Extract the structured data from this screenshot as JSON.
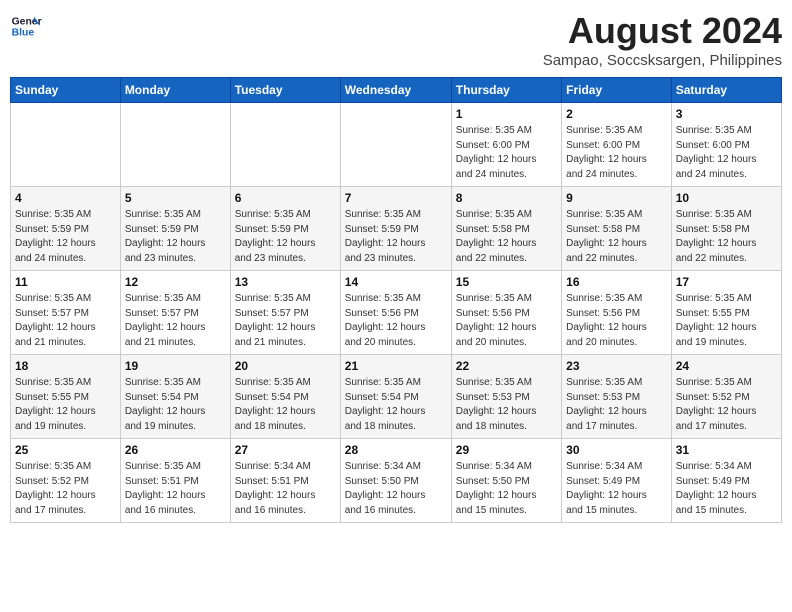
{
  "header": {
    "logo_line1": "General",
    "logo_line2": "Blue",
    "month_year": "August 2024",
    "location": "Sampao, Soccsksargen, Philippines"
  },
  "weekdays": [
    "Sunday",
    "Monday",
    "Tuesday",
    "Wednesday",
    "Thursday",
    "Friday",
    "Saturday"
  ],
  "weeks": [
    [
      {
        "day": "",
        "info": ""
      },
      {
        "day": "",
        "info": ""
      },
      {
        "day": "",
        "info": ""
      },
      {
        "day": "",
        "info": ""
      },
      {
        "day": "1",
        "info": "Sunrise: 5:35 AM\nSunset: 6:00 PM\nDaylight: 12 hours\nand 24 minutes."
      },
      {
        "day": "2",
        "info": "Sunrise: 5:35 AM\nSunset: 6:00 PM\nDaylight: 12 hours\nand 24 minutes."
      },
      {
        "day": "3",
        "info": "Sunrise: 5:35 AM\nSunset: 6:00 PM\nDaylight: 12 hours\nand 24 minutes."
      }
    ],
    [
      {
        "day": "4",
        "info": "Sunrise: 5:35 AM\nSunset: 5:59 PM\nDaylight: 12 hours\nand 24 minutes."
      },
      {
        "day": "5",
        "info": "Sunrise: 5:35 AM\nSunset: 5:59 PM\nDaylight: 12 hours\nand 23 minutes."
      },
      {
        "day": "6",
        "info": "Sunrise: 5:35 AM\nSunset: 5:59 PM\nDaylight: 12 hours\nand 23 minutes."
      },
      {
        "day": "7",
        "info": "Sunrise: 5:35 AM\nSunset: 5:59 PM\nDaylight: 12 hours\nand 23 minutes."
      },
      {
        "day": "8",
        "info": "Sunrise: 5:35 AM\nSunset: 5:58 PM\nDaylight: 12 hours\nand 22 minutes."
      },
      {
        "day": "9",
        "info": "Sunrise: 5:35 AM\nSunset: 5:58 PM\nDaylight: 12 hours\nand 22 minutes."
      },
      {
        "day": "10",
        "info": "Sunrise: 5:35 AM\nSunset: 5:58 PM\nDaylight: 12 hours\nand 22 minutes."
      }
    ],
    [
      {
        "day": "11",
        "info": "Sunrise: 5:35 AM\nSunset: 5:57 PM\nDaylight: 12 hours\nand 21 minutes."
      },
      {
        "day": "12",
        "info": "Sunrise: 5:35 AM\nSunset: 5:57 PM\nDaylight: 12 hours\nand 21 minutes."
      },
      {
        "day": "13",
        "info": "Sunrise: 5:35 AM\nSunset: 5:57 PM\nDaylight: 12 hours\nand 21 minutes."
      },
      {
        "day": "14",
        "info": "Sunrise: 5:35 AM\nSunset: 5:56 PM\nDaylight: 12 hours\nand 20 minutes."
      },
      {
        "day": "15",
        "info": "Sunrise: 5:35 AM\nSunset: 5:56 PM\nDaylight: 12 hours\nand 20 minutes."
      },
      {
        "day": "16",
        "info": "Sunrise: 5:35 AM\nSunset: 5:56 PM\nDaylight: 12 hours\nand 20 minutes."
      },
      {
        "day": "17",
        "info": "Sunrise: 5:35 AM\nSunset: 5:55 PM\nDaylight: 12 hours\nand 19 minutes."
      }
    ],
    [
      {
        "day": "18",
        "info": "Sunrise: 5:35 AM\nSunset: 5:55 PM\nDaylight: 12 hours\nand 19 minutes."
      },
      {
        "day": "19",
        "info": "Sunrise: 5:35 AM\nSunset: 5:54 PM\nDaylight: 12 hours\nand 19 minutes."
      },
      {
        "day": "20",
        "info": "Sunrise: 5:35 AM\nSunset: 5:54 PM\nDaylight: 12 hours\nand 18 minutes."
      },
      {
        "day": "21",
        "info": "Sunrise: 5:35 AM\nSunset: 5:54 PM\nDaylight: 12 hours\nand 18 minutes."
      },
      {
        "day": "22",
        "info": "Sunrise: 5:35 AM\nSunset: 5:53 PM\nDaylight: 12 hours\nand 18 minutes."
      },
      {
        "day": "23",
        "info": "Sunrise: 5:35 AM\nSunset: 5:53 PM\nDaylight: 12 hours\nand 17 minutes."
      },
      {
        "day": "24",
        "info": "Sunrise: 5:35 AM\nSunset: 5:52 PM\nDaylight: 12 hours\nand 17 minutes."
      }
    ],
    [
      {
        "day": "25",
        "info": "Sunrise: 5:35 AM\nSunset: 5:52 PM\nDaylight: 12 hours\nand 17 minutes."
      },
      {
        "day": "26",
        "info": "Sunrise: 5:35 AM\nSunset: 5:51 PM\nDaylight: 12 hours\nand 16 minutes."
      },
      {
        "day": "27",
        "info": "Sunrise: 5:34 AM\nSunset: 5:51 PM\nDaylight: 12 hours\nand 16 minutes."
      },
      {
        "day": "28",
        "info": "Sunrise: 5:34 AM\nSunset: 5:50 PM\nDaylight: 12 hours\nand 16 minutes."
      },
      {
        "day": "29",
        "info": "Sunrise: 5:34 AM\nSunset: 5:50 PM\nDaylight: 12 hours\nand 15 minutes."
      },
      {
        "day": "30",
        "info": "Sunrise: 5:34 AM\nSunset: 5:49 PM\nDaylight: 12 hours\nand 15 minutes."
      },
      {
        "day": "31",
        "info": "Sunrise: 5:34 AM\nSunset: 5:49 PM\nDaylight: 12 hours\nand 15 minutes."
      }
    ]
  ]
}
